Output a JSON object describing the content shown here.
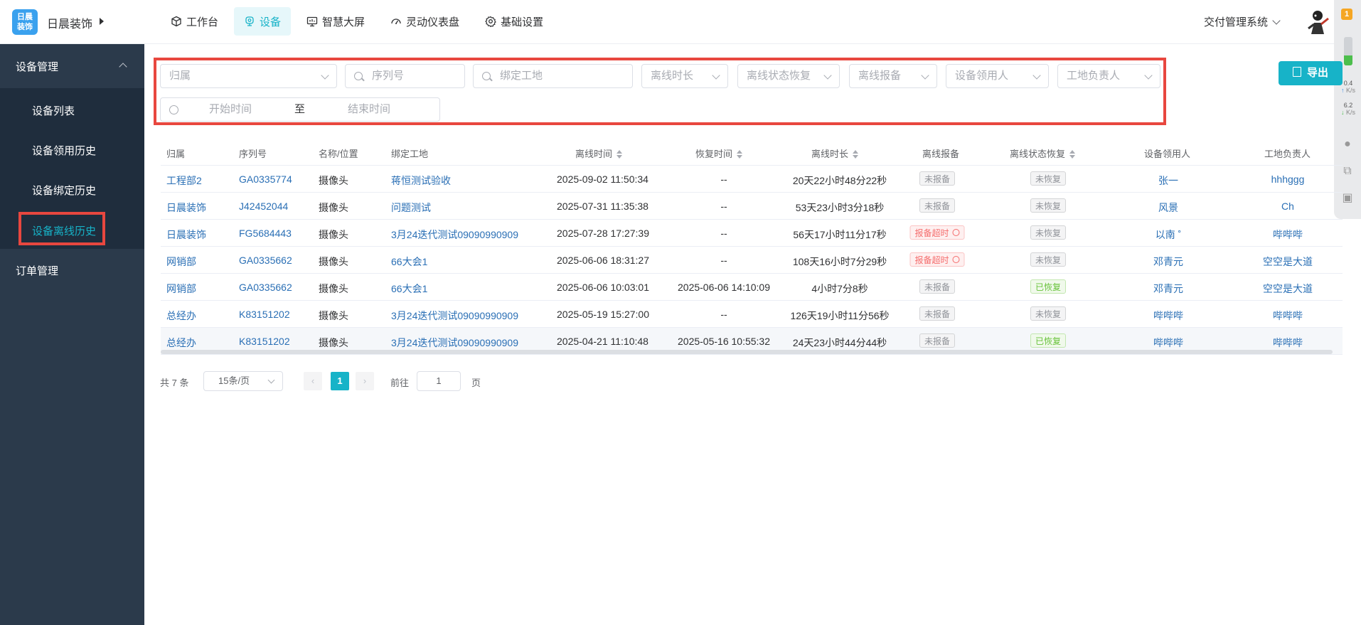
{
  "app": {
    "logo_text": "日晨装饰",
    "company": "日晨装饰",
    "system_switch": "交付管理系统"
  },
  "nav": [
    {
      "label": "工作台",
      "icon": "cube-icon",
      "active": false
    },
    {
      "label": "设备",
      "icon": "device-icon",
      "active": true
    },
    {
      "label": "智慧大屏",
      "icon": "monitor-icon",
      "active": false
    },
    {
      "label": "灵动仪表盘",
      "icon": "gauge-icon",
      "active": false
    },
    {
      "label": "基础设置",
      "icon": "gear-icon",
      "active": false
    }
  ],
  "widget": {
    "badge": "1",
    "meter_level": 0.35,
    "up_value": "0.4",
    "up_unit": "K/s",
    "down_value": "6.2",
    "down_unit": "K/s"
  },
  "sidebar": {
    "group": "设备管理",
    "items": [
      "设备列表",
      "设备领用历史",
      "设备绑定历史",
      "设备离线历史"
    ],
    "active_item": "设备离线历史",
    "order_group": "订单管理"
  },
  "filters": {
    "belong": "归属",
    "serial": "序列号",
    "site": "绑定工地",
    "offline_duration": "离线时长",
    "offline_restore": "离线状态恢复",
    "offline_report": "离线报备",
    "receiver": "设备领用人",
    "site_manager": "工地负责人",
    "start_time": "开始时间",
    "range_sep": "至",
    "end_time": "结束时间"
  },
  "export_label": "导出",
  "table": {
    "headers": [
      "归属",
      "序列号",
      "名称/位置",
      "绑定工地",
      "离线时间",
      "恢复时间",
      "离线时长",
      "离线报备",
      "离线状态恢复",
      "设备领用人",
      "工地负责人"
    ],
    "rows": [
      {
        "belong": "工程部2",
        "serial": "GA0335774",
        "name": "摄像头",
        "site": "蒋恒测试验收",
        "offline": "2025-09-02 11:50:34",
        "restore": "--",
        "duration": "20天22小时48分22秒",
        "report": "未报备",
        "report_type": "gray",
        "status": "未恢复",
        "status_type": "gray",
        "receiver": "张一",
        "manager": "hhhggg"
      },
      {
        "belong": "日晨装饰",
        "serial": "J42452044",
        "name": "摄像头",
        "site": "问题测试",
        "offline": "2025-07-31 11:35:38",
        "restore": "--",
        "duration": "53天23小时3分18秒",
        "report": "未报备",
        "report_type": "gray",
        "status": "未恢复",
        "status_type": "gray",
        "receiver": "风景",
        "manager": "Ch"
      },
      {
        "belong": "日晨装饰",
        "serial": "FG5684443",
        "name": "摄像头",
        "site": "3月24迭代测试09090990909",
        "offline": "2025-07-28 17:27:39",
        "restore": "--",
        "duration": "56天17小时11分17秒",
        "report": "报备超时",
        "report_type": "red",
        "status": "未恢复",
        "status_type": "gray",
        "receiver": "以南 ˚",
        "manager": "哔哔哔"
      },
      {
        "belong": "网销部",
        "serial": "GA0335662",
        "name": "摄像头",
        "site": "66大会1",
        "offline": "2025-06-06 18:31:27",
        "restore": "--",
        "duration": "108天16小时7分29秒",
        "report": "报备超时",
        "report_type": "red",
        "status": "未恢复",
        "status_type": "gray",
        "receiver": "邓青元",
        "manager": "空空是大道"
      },
      {
        "belong": "网销部",
        "serial": "GA0335662",
        "name": "摄像头",
        "site": "66大会1",
        "offline": "2025-06-06 10:03:01",
        "restore": "2025-06-06 14:10:09",
        "duration": "4小时7分8秒",
        "report": "未报备",
        "report_type": "gray",
        "status": "已恢复",
        "status_type": "green",
        "receiver": "邓青元",
        "manager": "空空是大道"
      },
      {
        "belong": "总经办",
        "serial": "K83151202",
        "name": "摄像头",
        "site": "3月24迭代测试09090990909",
        "offline": "2025-05-19 15:27:00",
        "restore": "--",
        "duration": "126天19小时11分56秒",
        "report": "未报备",
        "report_type": "gray",
        "status": "未恢复",
        "status_type": "gray",
        "receiver": "哔哔哔",
        "manager": "哔哔哔"
      },
      {
        "belong": "总经办",
        "serial": "K83151202",
        "name": "摄像头",
        "site": "3月24迭代测试09090990909",
        "offline": "2025-04-21 11:10:48",
        "restore": "2025-05-16 10:55:32",
        "duration": "24天23小时44分44秒",
        "report": "未报备",
        "report_type": "gray",
        "status": "已恢复",
        "status_type": "green",
        "receiver": "哔哔哔",
        "manager": "哔哔哔"
      }
    ]
  },
  "pagination": {
    "total": "共 7 条",
    "page_size": "15条/页",
    "prev": "‹",
    "current": "1",
    "next": "›",
    "goto_label": "前往",
    "goto_value": "1",
    "page_suffix": "页"
  }
}
